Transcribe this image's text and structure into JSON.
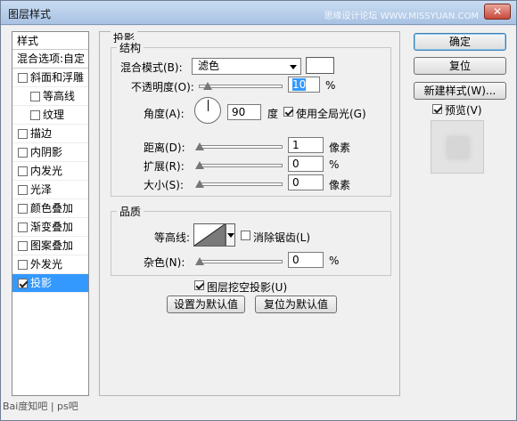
{
  "window": {
    "title": "图层样式",
    "watermark": "思缘设计论坛 WWW.MISSYUAN.COM",
    "close_glyph": "✕"
  },
  "styles_list": {
    "header": "样式",
    "blend_options": "混合选项:自定",
    "items": [
      {
        "label": "斜面和浮雕",
        "checked": false,
        "sub": false,
        "selected": false
      },
      {
        "label": "等高线",
        "checked": false,
        "sub": true,
        "selected": false
      },
      {
        "label": "纹理",
        "checked": false,
        "sub": true,
        "selected": false
      },
      {
        "label": "描边",
        "checked": false,
        "sub": false,
        "selected": false
      },
      {
        "label": "内阴影",
        "checked": false,
        "sub": false,
        "selected": false
      },
      {
        "label": "内发光",
        "checked": false,
        "sub": false,
        "selected": false
      },
      {
        "label": "光泽",
        "checked": false,
        "sub": false,
        "selected": false
      },
      {
        "label": "颜色叠加",
        "checked": false,
        "sub": false,
        "selected": false
      },
      {
        "label": "渐变叠加",
        "checked": false,
        "sub": false,
        "selected": false
      },
      {
        "label": "图案叠加",
        "checked": false,
        "sub": false,
        "selected": false
      },
      {
        "label": "外发光",
        "checked": false,
        "sub": false,
        "selected": false
      },
      {
        "label": "投影",
        "checked": true,
        "sub": false,
        "selected": true
      }
    ]
  },
  "drop_shadow": {
    "title": "投影",
    "structure": {
      "title": "结构",
      "blend_mode_label": "混合模式(B):",
      "blend_mode_value": "滤色",
      "opacity_label": "不透明度(O):",
      "opacity_value": "10",
      "opacity_fraction": 0.1,
      "opacity_unit": "%",
      "angle_label": "角度(A):",
      "angle_value": "90",
      "angle_unit": "度",
      "global_light_label": "使用全局光(G)",
      "global_light_checked": true,
      "distance_label": "距离(D):",
      "distance_value": "1",
      "distance_unit": "像素",
      "spread_label": "扩展(R):",
      "spread_value": "0",
      "spread_unit": "%",
      "size_label": "大小(S):",
      "size_value": "0",
      "size_unit": "像素"
    },
    "quality": {
      "title": "品质",
      "contour_label": "等高线:",
      "anti_alias_label": "消除锯齿(L)",
      "anti_alias_checked": false,
      "noise_label": "杂色(N):",
      "noise_value": "0",
      "noise_unit": "%"
    },
    "knockout_label": "图层挖空投影(U)",
    "knockout_checked": true,
    "make_default_label": "设置为默认值",
    "reset_default_label": "复位为默认值"
  },
  "buttons": {
    "ok": "确定",
    "reset": "复位",
    "new_style": "新建样式(W)...",
    "preview_label": "预览(V)",
    "preview_checked": true
  },
  "footer_watermark": "Bai度知吧 | ps吧"
}
